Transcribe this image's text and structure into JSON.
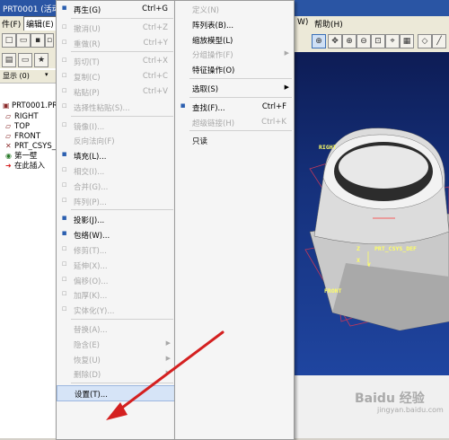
{
  "window": {
    "title": "PRT0001 (活动",
    "menus": [
      {
        "label": "件(F)"
      },
      {
        "label": "编辑(E)"
      },
      {
        "label": "W)"
      },
      {
        "label": "帮助(H)"
      }
    ]
  },
  "model_tree": {
    "display_label": "显示 (0)",
    "items": [
      {
        "label": "PRT0001.PRT",
        "icon": "part-icon"
      },
      {
        "label": "RIGHT",
        "icon": "datum-plane-icon"
      },
      {
        "label": "TOP",
        "icon": "datum-plane-icon"
      },
      {
        "label": "FRONT",
        "icon": "datum-plane-icon"
      },
      {
        "label": "PRT_CSYS_D",
        "icon": "csys-icon"
      },
      {
        "label": "第一壁",
        "icon": "feature-icon"
      },
      {
        "label": "在此插入",
        "icon": "insert-here-icon"
      }
    ]
  },
  "edit_menu": {
    "items": [
      {
        "label": "再生(G)",
        "shortcut": "Ctrl+G",
        "enabled": true,
        "icon": "regenerate-icon"
      },
      {
        "sep": true
      },
      {
        "label": "撤消(U)",
        "shortcut": "Ctrl+Z",
        "enabled": false,
        "icon": "undo-icon"
      },
      {
        "label": "重做(R)",
        "shortcut": "Ctrl+Y",
        "enabled": false,
        "icon": "redo-icon"
      },
      {
        "sep": true
      },
      {
        "label": "剪切(T)",
        "shortcut": "Ctrl+X",
        "enabled": false,
        "icon": "cut-icon"
      },
      {
        "label": "复制(C)",
        "shortcut": "Ctrl+C",
        "enabled": false,
        "icon": "copy-icon"
      },
      {
        "label": "粘贴(P)",
        "shortcut": "Ctrl+V",
        "enabled": false,
        "icon": "paste-icon"
      },
      {
        "label": "选择性粘贴(S)...",
        "shortcut": "",
        "enabled": false,
        "icon": "paste-special-icon"
      },
      {
        "sep": true
      },
      {
        "label": "镜像(I)...",
        "shortcut": "",
        "enabled": false,
        "icon": "mirror-icon"
      },
      {
        "label": "反向法向(F)",
        "shortcut": "",
        "enabled": false,
        "icon": ""
      },
      {
        "label": "填充(L)...",
        "shortcut": "",
        "enabled": true,
        "icon": "fill-icon"
      },
      {
        "label": "相交(I)...",
        "shortcut": "",
        "enabled": false,
        "icon": "intersect-icon"
      },
      {
        "label": "合并(G)...",
        "shortcut": "",
        "enabled": false,
        "icon": "merge-icon"
      },
      {
        "label": "阵列(P)...",
        "shortcut": "",
        "enabled": false,
        "icon": "pattern-icon"
      },
      {
        "sep": true
      },
      {
        "label": "投影(J)...",
        "shortcut": "",
        "enabled": true,
        "icon": "project-icon"
      },
      {
        "label": "包络(W)...",
        "shortcut": "",
        "enabled": true,
        "icon": "wrap-icon"
      },
      {
        "label": "修剪(T)...",
        "shortcut": "",
        "enabled": false,
        "icon": "trim-icon"
      },
      {
        "label": "延伸(X)...",
        "shortcut": "",
        "enabled": false,
        "icon": "extend-icon"
      },
      {
        "label": "偏移(O)...",
        "shortcut": "",
        "enabled": false,
        "icon": "offset-icon"
      },
      {
        "label": "加厚(K)...",
        "shortcut": "",
        "enabled": false,
        "icon": "thicken-icon"
      },
      {
        "label": "实体化(Y)...",
        "shortcut": "",
        "enabled": false,
        "icon": "solidify-icon"
      },
      {
        "sep": true
      },
      {
        "label": "替换(A)...",
        "shortcut": "",
        "enabled": false,
        "icon": ""
      },
      {
        "label": "隐含(E)",
        "shortcut": "",
        "enabled": false,
        "icon": "",
        "submenu": true
      },
      {
        "label": "恢复(U)",
        "shortcut": "",
        "enabled": false,
        "icon": "",
        "submenu": true
      },
      {
        "label": "删除(D)",
        "shortcut": "",
        "enabled": false,
        "icon": "",
        "submenu": true
      },
      {
        "sep": true
      },
      {
        "label": "设置(T)...",
        "shortcut": "",
        "enabled": true,
        "icon": "",
        "highlighted": true
      }
    ]
  },
  "sub_menu": {
    "items": [
      {
        "label": "定义(N)",
        "shortcut": "",
        "enabled": false
      },
      {
        "label": "阵列表(B)...",
        "shortcut": "",
        "enabled": true
      },
      {
        "label": "缩放模型(L)",
        "shortcut": "",
        "enabled": true
      },
      {
        "label": "分组操作(F)",
        "shortcut": "",
        "enabled": false,
        "submenu": true
      },
      {
        "label": "特征操作(O)",
        "shortcut": "",
        "enabled": true
      },
      {
        "sep": true
      },
      {
        "label": "选取(S)",
        "shortcut": "",
        "enabled": true,
        "submenu": true
      },
      {
        "sep": true
      },
      {
        "label": "查找(F)...",
        "shortcut": "Ctrl+F",
        "enabled": true,
        "icon": "binoculars-icon"
      },
      {
        "label": "超级链接(H)",
        "shortcut": "Ctrl+K",
        "enabled": false
      },
      {
        "sep": true
      },
      {
        "label": "只读",
        "shortcut": "",
        "enabled": true
      }
    ]
  },
  "viewport": {
    "labels": {
      "right": "RIGHT",
      "csys": "PRT_CSYS_DEF",
      "front": "FRONT",
      "z": "Z",
      "x": "X",
      "y": "Y"
    }
  },
  "watermark": {
    "text": "Baidu 经验",
    "sub": "jingyan.baidu.com"
  },
  "colors": {
    "arrow": "#d42020",
    "viewport_top": "#0d1c55",
    "viewport_bottom": "#1f45a0",
    "datum": "#c0385a"
  }
}
